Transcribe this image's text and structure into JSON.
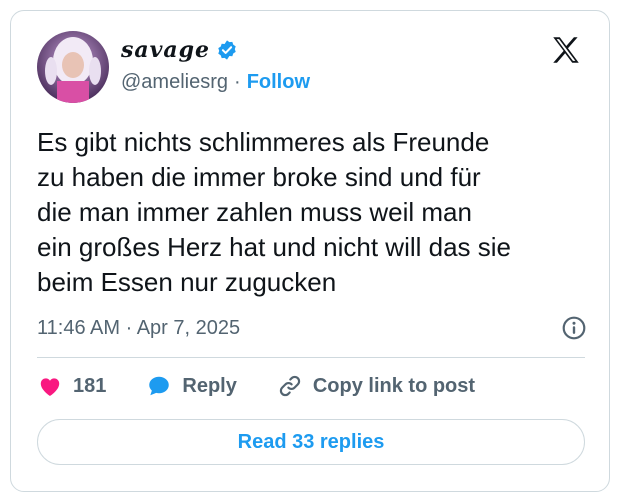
{
  "author": {
    "display_name": "savage",
    "handle": "@ameliesrg",
    "separator": "·",
    "follow_label": "Follow",
    "verified_icon": "verified-badge-icon"
  },
  "platform_logo": "x-logo-icon",
  "tweet": {
    "text_lines": [
      "Es gibt nichts schlimmeres als Freunde",
      "zu haben die immer broke sind und für",
      "die man immer zahlen muss weil man",
      "ein großes Herz hat und nicht will das sie",
      "beim Essen nur zugucken"
    ],
    "timestamp": "11:46 AM · Apr 7, 2025"
  },
  "actions": {
    "like_count": "181",
    "reply_label": "Reply",
    "copy_label": "Copy link to post"
  },
  "read_replies_label": "Read 33 replies",
  "colors": {
    "accent": "#1d9bf0",
    "like": "#f91880",
    "text": "#0f1419",
    "muted": "#536471",
    "border": "#cfd9de"
  }
}
